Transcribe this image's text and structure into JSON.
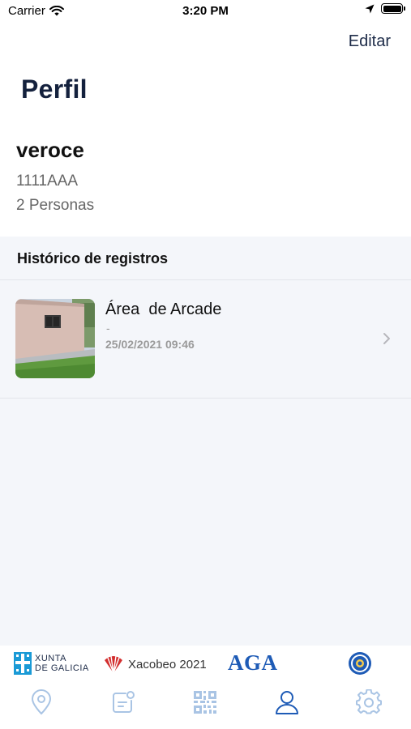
{
  "status_bar": {
    "carrier": "Carrier",
    "time": "3:20 PM"
  },
  "header": {
    "edit_label": "Editar",
    "title": "Perfil"
  },
  "profile": {
    "username": "veroce",
    "plate": "1111AAA",
    "persons": "2 Personas"
  },
  "history": {
    "section_title": "Histórico de registros",
    "records": [
      {
        "title": "Área  de Arcade",
        "subtitle": "-",
        "date": "25/02/2021 09:46"
      }
    ]
  },
  "footer_logos": {
    "xunta_line1": "XUNTA",
    "xunta_line2": "DE GALICIA",
    "xacobeo": "Xacobeo 2021",
    "aga": "AGA"
  },
  "tabbar": {
    "tabs": [
      {
        "icon": "location-pin-icon",
        "active": false
      },
      {
        "icon": "chat-note-icon",
        "active": false
      },
      {
        "icon": "qr-code-icon",
        "active": false
      },
      {
        "icon": "profile-icon",
        "active": true
      },
      {
        "icon": "settings-gear-icon",
        "active": false
      }
    ]
  },
  "colors": {
    "accent": "#1e5bb6",
    "tab_inactive": "#a9c4e4",
    "tab_active": "#1e5bb6",
    "title": "#14213d",
    "background": "#f4f6fa"
  }
}
